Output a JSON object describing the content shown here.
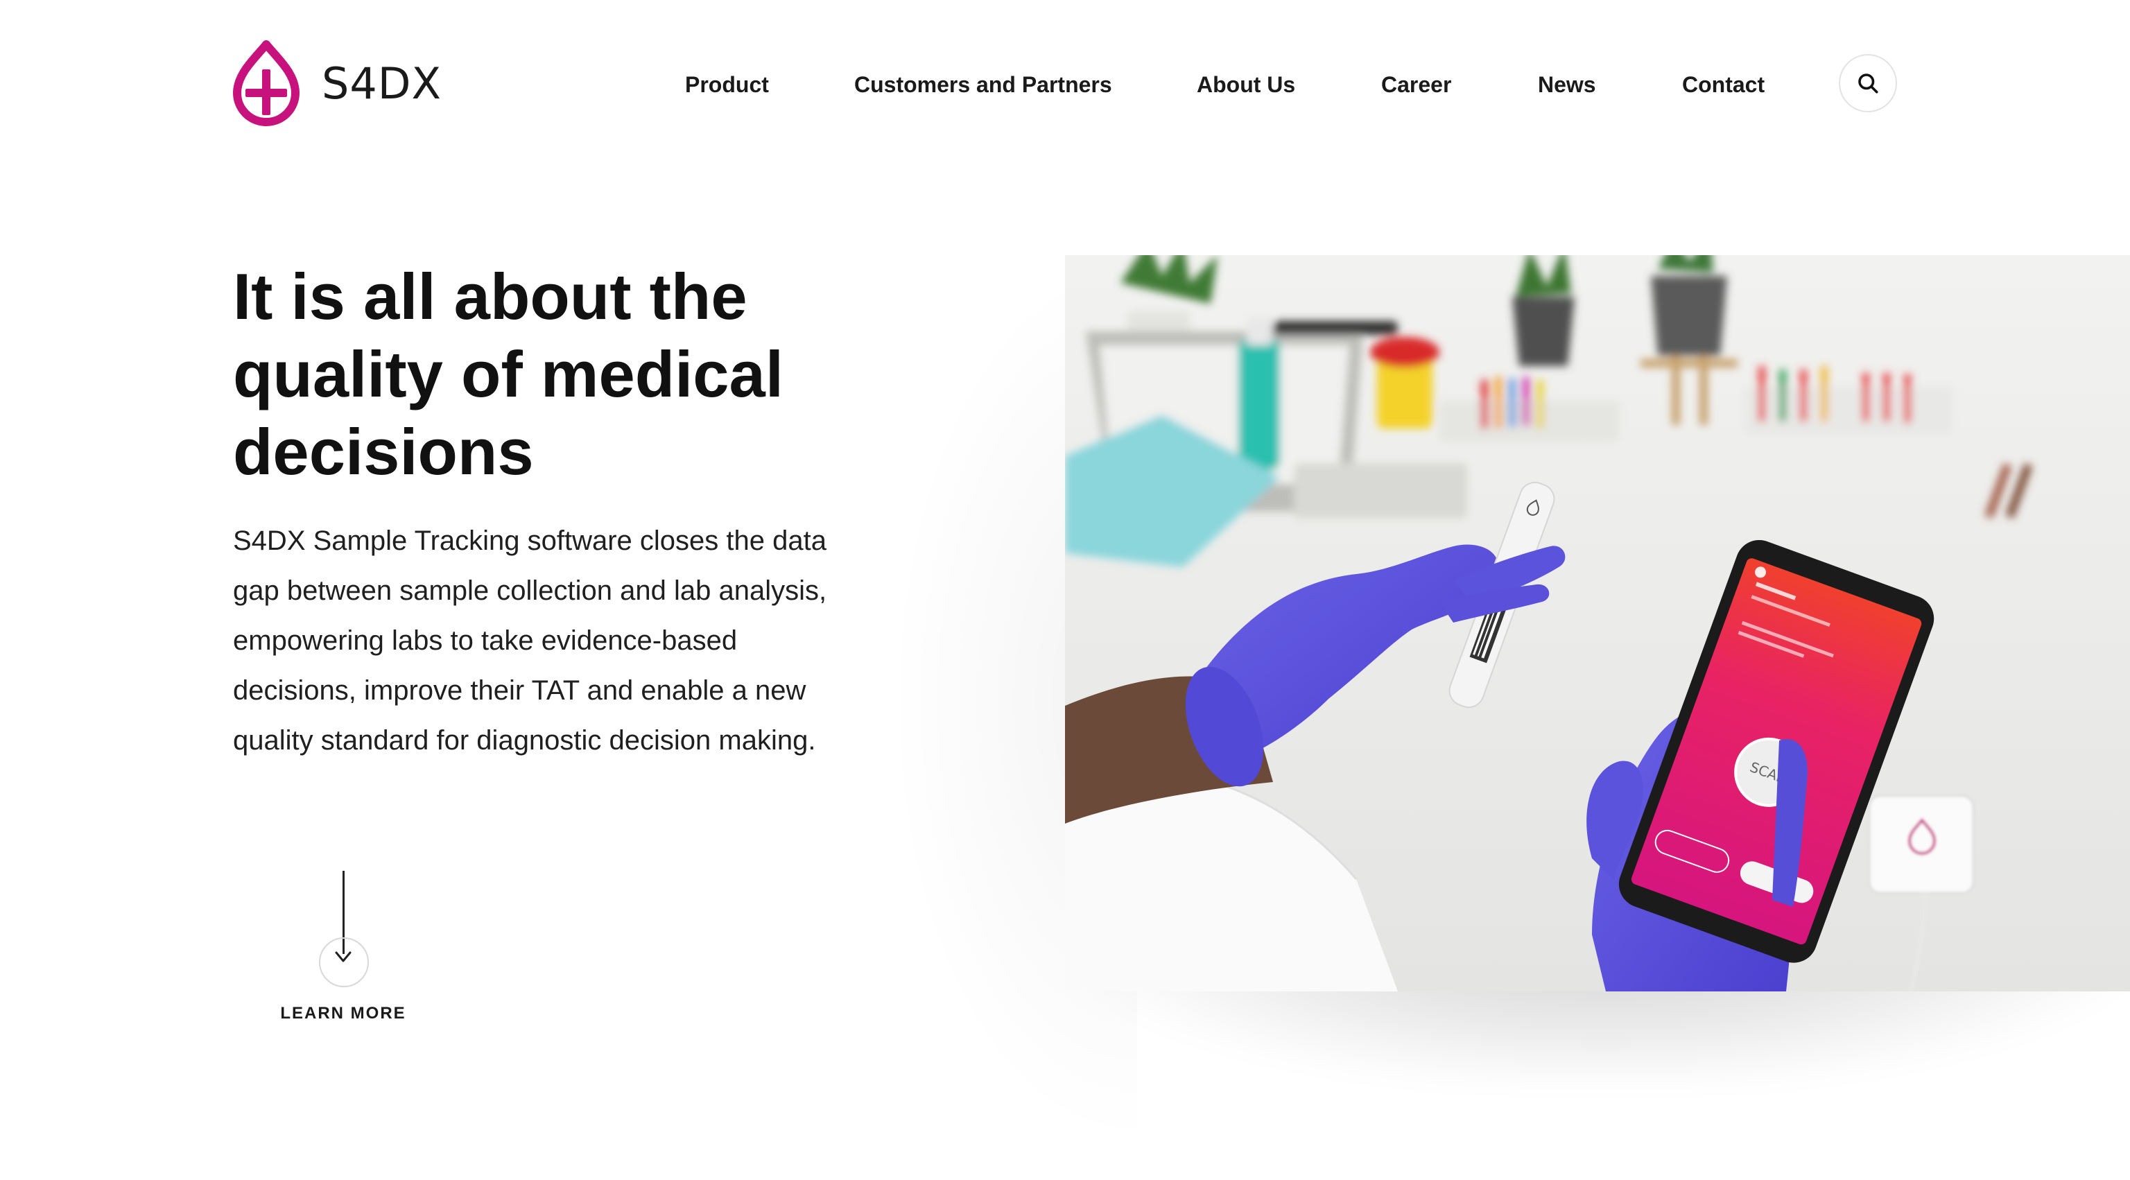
{
  "brand": {
    "name": "S4DX",
    "accent_color": "#c7127e",
    "logo_icon": "drop-plus-logo-icon"
  },
  "nav": {
    "items": [
      {
        "label": "Product"
      },
      {
        "label": "Customers and Partners"
      },
      {
        "label": "About Us"
      },
      {
        "label": "Career"
      },
      {
        "label": "News"
      },
      {
        "label": "Contact"
      }
    ],
    "search_icon": "search-icon"
  },
  "hero": {
    "title_lines": [
      "It is all about the",
      "quality of medical",
      "decisions"
    ],
    "body_lines": [
      "S4DX Sample Tracking software closes the data",
      "gap between sample collection and lab analysis,",
      "empowering labs to take evidence-based",
      "decisions, improve their TAT and enable a new",
      "quality standard for diagnostic decision making."
    ],
    "learn_more": {
      "label": "LEARN MORE",
      "icon": "arrow-down-icon"
    }
  },
  "photo": {
    "phone_scan_label": "SCAN"
  }
}
